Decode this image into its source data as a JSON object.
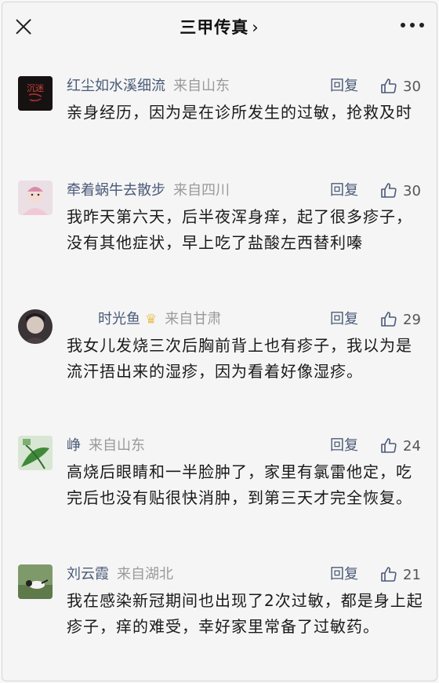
{
  "header": {
    "title": "三甲传真",
    "chevron": "›"
  },
  "comments": [
    {
      "user": "红尘如水溪细流",
      "location": "来自山东",
      "reply": "回复",
      "likes": "30",
      "text": "亲身经历，因为是在诊所发生的过敏，抢救及时",
      "avatar_text": "沉迷"
    },
    {
      "user": "牵着蜗牛去散步",
      "location": "来自四川",
      "reply": "回复",
      "likes": "30",
      "text": "我昨天第六天，后半夜浑身痒，起了很多疹子，没有其他症状，早上吃了盐酸左西替利嗪"
    },
    {
      "user": "时光鱼",
      "location": "来自甘肃",
      "reply": "回复",
      "likes": "29",
      "text": "我女儿发烧三次后胸前背上也有疹子，我以为是流汗捂出来的湿疹，因为看着好像湿疹。"
    },
    {
      "user": "峥",
      "location": "来自山东",
      "reply": "回复",
      "likes": "24",
      "text": "高烧后眼睛和一半脸肿了，家里有氯雷他定，吃完后也没有贴很快消肿，到第三天才完全恢复。"
    },
    {
      "user": "刘云霞",
      "location": "来自湖北",
      "reply": "回复",
      "likes": "21",
      "text": "我在感染新冠期间也出现了2次过敏，都是身上起疹子，痒的难受，幸好家里常备了过敏药。"
    }
  ]
}
